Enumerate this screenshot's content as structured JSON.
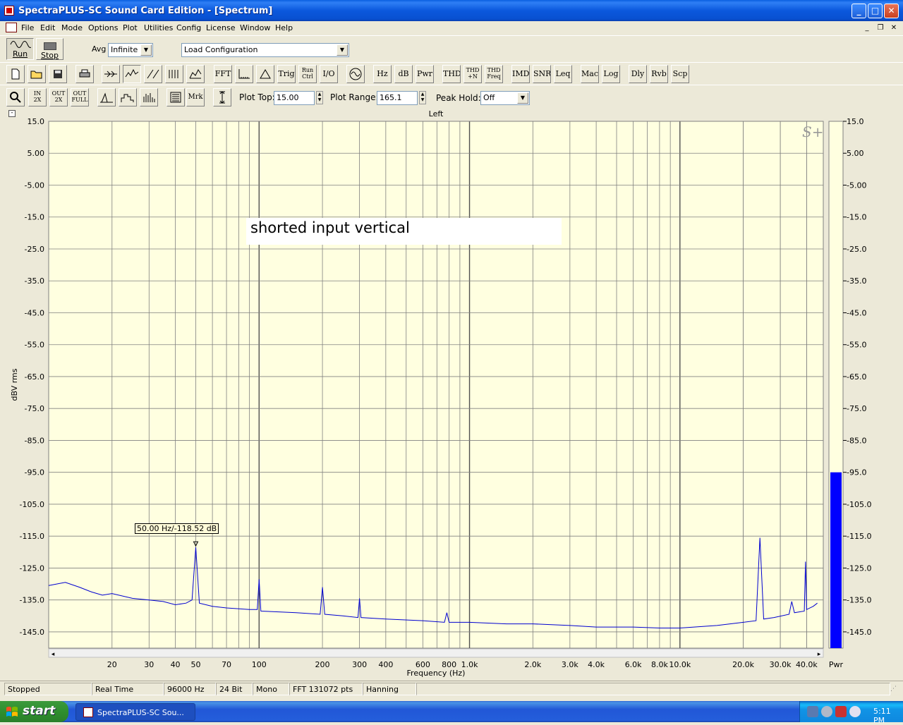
{
  "window": {
    "title": "SpectraPLUS-SC Sound Card Edition - [Spectrum]",
    "minimize_glyph": "_",
    "maximize_glyph": "□",
    "close_glyph": "✕"
  },
  "menu": {
    "items": [
      "File",
      "Edit",
      "Mode",
      "Options",
      "Plot",
      "Utilities",
      "Config",
      "License",
      "Window",
      "Help"
    ],
    "mdi_minimize": "_",
    "mdi_restore": "❐",
    "mdi_close": "✕"
  },
  "toolbar1": {
    "run_label": "Run",
    "stop_label": "Stop",
    "avg_label": "Avg",
    "avg_value": "Infinite",
    "config_value": "Load Configuration"
  },
  "toolbar2": {
    "buttons": [
      "FFT",
      "Trig",
      "I/O",
      "Hz",
      "dB",
      "Pwr",
      "THD",
      "IMD",
      "SNR",
      "Leq",
      "Mac",
      "Log",
      "Dly",
      "Rvb",
      "Scp"
    ],
    "runctrl": [
      "Run",
      "Ctrl"
    ],
    "thdn": [
      "THD",
      "+N"
    ],
    "thdfreq": [
      "THD",
      "Freq"
    ]
  },
  "toolbar3": {
    "zoom_in": [
      "IN",
      "2X"
    ],
    "zoom_out": [
      "OUT",
      "2X"
    ],
    "zoom_full": [
      "OUT",
      "FULL"
    ],
    "mrk_label": "Mrk",
    "plot_top_label": "Plot Top:",
    "plot_top_value": "15.00",
    "plot_range_label": "Plot Range:",
    "plot_range_value": "165.1",
    "peak_hold_label": "Peak Hold:",
    "peak_hold_value": "Off"
  },
  "plot": {
    "channel_label": "Left",
    "collapse_glyph": "-",
    "annotation": "shorted input vertical",
    "watermark": "S+",
    "marker_text": "50.00 Hz/-118.52 dB",
    "meter_label": "Pwr",
    "colors": {
      "background": "#ffffe0",
      "trace": "#0000d0",
      "grid": "#808080",
      "meter": "#0000ff"
    }
  },
  "chart_data": {
    "type": "line",
    "title": "Left",
    "xlabel": "Frequency (Hz)",
    "ylabel": "dBV rms",
    "x_scale": "log",
    "xlim": [
      10,
      48000
    ],
    "ylim": [
      -150.1,
      15
    ],
    "y_ticks": [
      "15.0",
      "5.00",
      "-5.00",
      "-15.0",
      "-25.0",
      "-35.0",
      "-45.0",
      "-55.0",
      "-65.0",
      "-75.0",
      "-85.0",
      "-95.0",
      "-105.0",
      "-115.0",
      "-125.0",
      "-135.0",
      "-145.0"
    ],
    "x_tick_labels": [
      {
        "x": 20,
        "label": "20"
      },
      {
        "x": 30,
        "label": "30"
      },
      {
        "x": 40,
        "label": "40"
      },
      {
        "x": 50,
        "label": "50"
      },
      {
        "x": 70,
        "label": "70"
      },
      {
        "x": 100,
        "label": "100"
      },
      {
        "x": 200,
        "label": "200"
      },
      {
        "x": 300,
        "label": "300"
      },
      {
        "x": 400,
        "label": "400"
      },
      {
        "x": 600,
        "label": "600"
      },
      {
        "x": 800,
        "label": "800"
      },
      {
        "x": 1000,
        "label": "1.0k"
      },
      {
        "x": 2000,
        "label": "2.0k"
      },
      {
        "x": 3000,
        "label": "3.0k"
      },
      {
        "x": 4000,
        "label": "4.0k"
      },
      {
        "x": 6000,
        "label": "6.0k"
      },
      {
        "x": 8000,
        "label": "8.0k"
      },
      {
        "x": 10000,
        "label": "10.0k"
      },
      {
        "x": 20000,
        "label": "20.0k"
      },
      {
        "x": 30000,
        "label": "30.0k"
      },
      {
        "x": 40000,
        "label": "40.0k"
      }
    ],
    "series": [
      {
        "points": [
          [
            10,
            -130.5
          ],
          [
            12,
            -129.5
          ],
          [
            14,
            -131
          ],
          [
            16,
            -132.5
          ],
          [
            18,
            -133.5
          ],
          [
            20,
            -133
          ],
          [
            25,
            -134.5
          ],
          [
            30,
            -135
          ],
          [
            35,
            -135.5
          ],
          [
            40,
            -136.5
          ],
          [
            45,
            -136
          ],
          [
            48,
            -135
          ],
          [
            50,
            -118.5
          ],
          [
            52,
            -136
          ],
          [
            60,
            -137
          ],
          [
            70,
            -137.5
          ],
          [
            90,
            -138
          ],
          [
            98,
            -138
          ],
          [
            100,
            -128.5
          ],
          [
            102,
            -138.5
          ],
          [
            150,
            -139
          ],
          [
            195,
            -139.5
          ],
          [
            200,
            -131
          ],
          [
            205,
            -139.5
          ],
          [
            250,
            -140
          ],
          [
            295,
            -140.5
          ],
          [
            300,
            -134.5
          ],
          [
            305,
            -140.5
          ],
          [
            400,
            -141
          ],
          [
            600,
            -141.5
          ],
          [
            760,
            -142
          ],
          [
            780,
            -139
          ],
          [
            800,
            -142
          ],
          [
            1000,
            -142
          ],
          [
            1500,
            -142.5
          ],
          [
            2000,
            -142.5
          ],
          [
            3000,
            -143
          ],
          [
            4000,
            -143.5
          ],
          [
            6000,
            -143.5
          ],
          [
            8000,
            -143.8
          ],
          [
            10000,
            -143.8
          ],
          [
            15000,
            -143
          ],
          [
            20000,
            -142
          ],
          [
            23000,
            -141.5
          ],
          [
            24000,
            -115.5
          ],
          [
            25000,
            -141
          ],
          [
            28000,
            -140.5
          ],
          [
            33000,
            -139.5
          ],
          [
            34000,
            -135.5
          ],
          [
            35000,
            -139
          ],
          [
            39000,
            -138.5
          ],
          [
            39500,
            -123
          ],
          [
            40000,
            -138
          ],
          [
            43000,
            -137
          ],
          [
            45000,
            -136
          ]
        ]
      }
    ],
    "meter": {
      "value": -95.0,
      "ylim": [
        -150.1,
        15
      ]
    },
    "marker": {
      "x": 50,
      "y": -118.52
    }
  },
  "status": {
    "cells": [
      "Stopped",
      "Real Time",
      "96000 Hz",
      "24 Bit",
      "Mono",
      "FFT 131072 pts",
      "Hanning"
    ]
  },
  "taskbar": {
    "start_label": "start",
    "task_label": "SpectraPLUS-SC Sou...",
    "clock": "5:11 PM"
  }
}
